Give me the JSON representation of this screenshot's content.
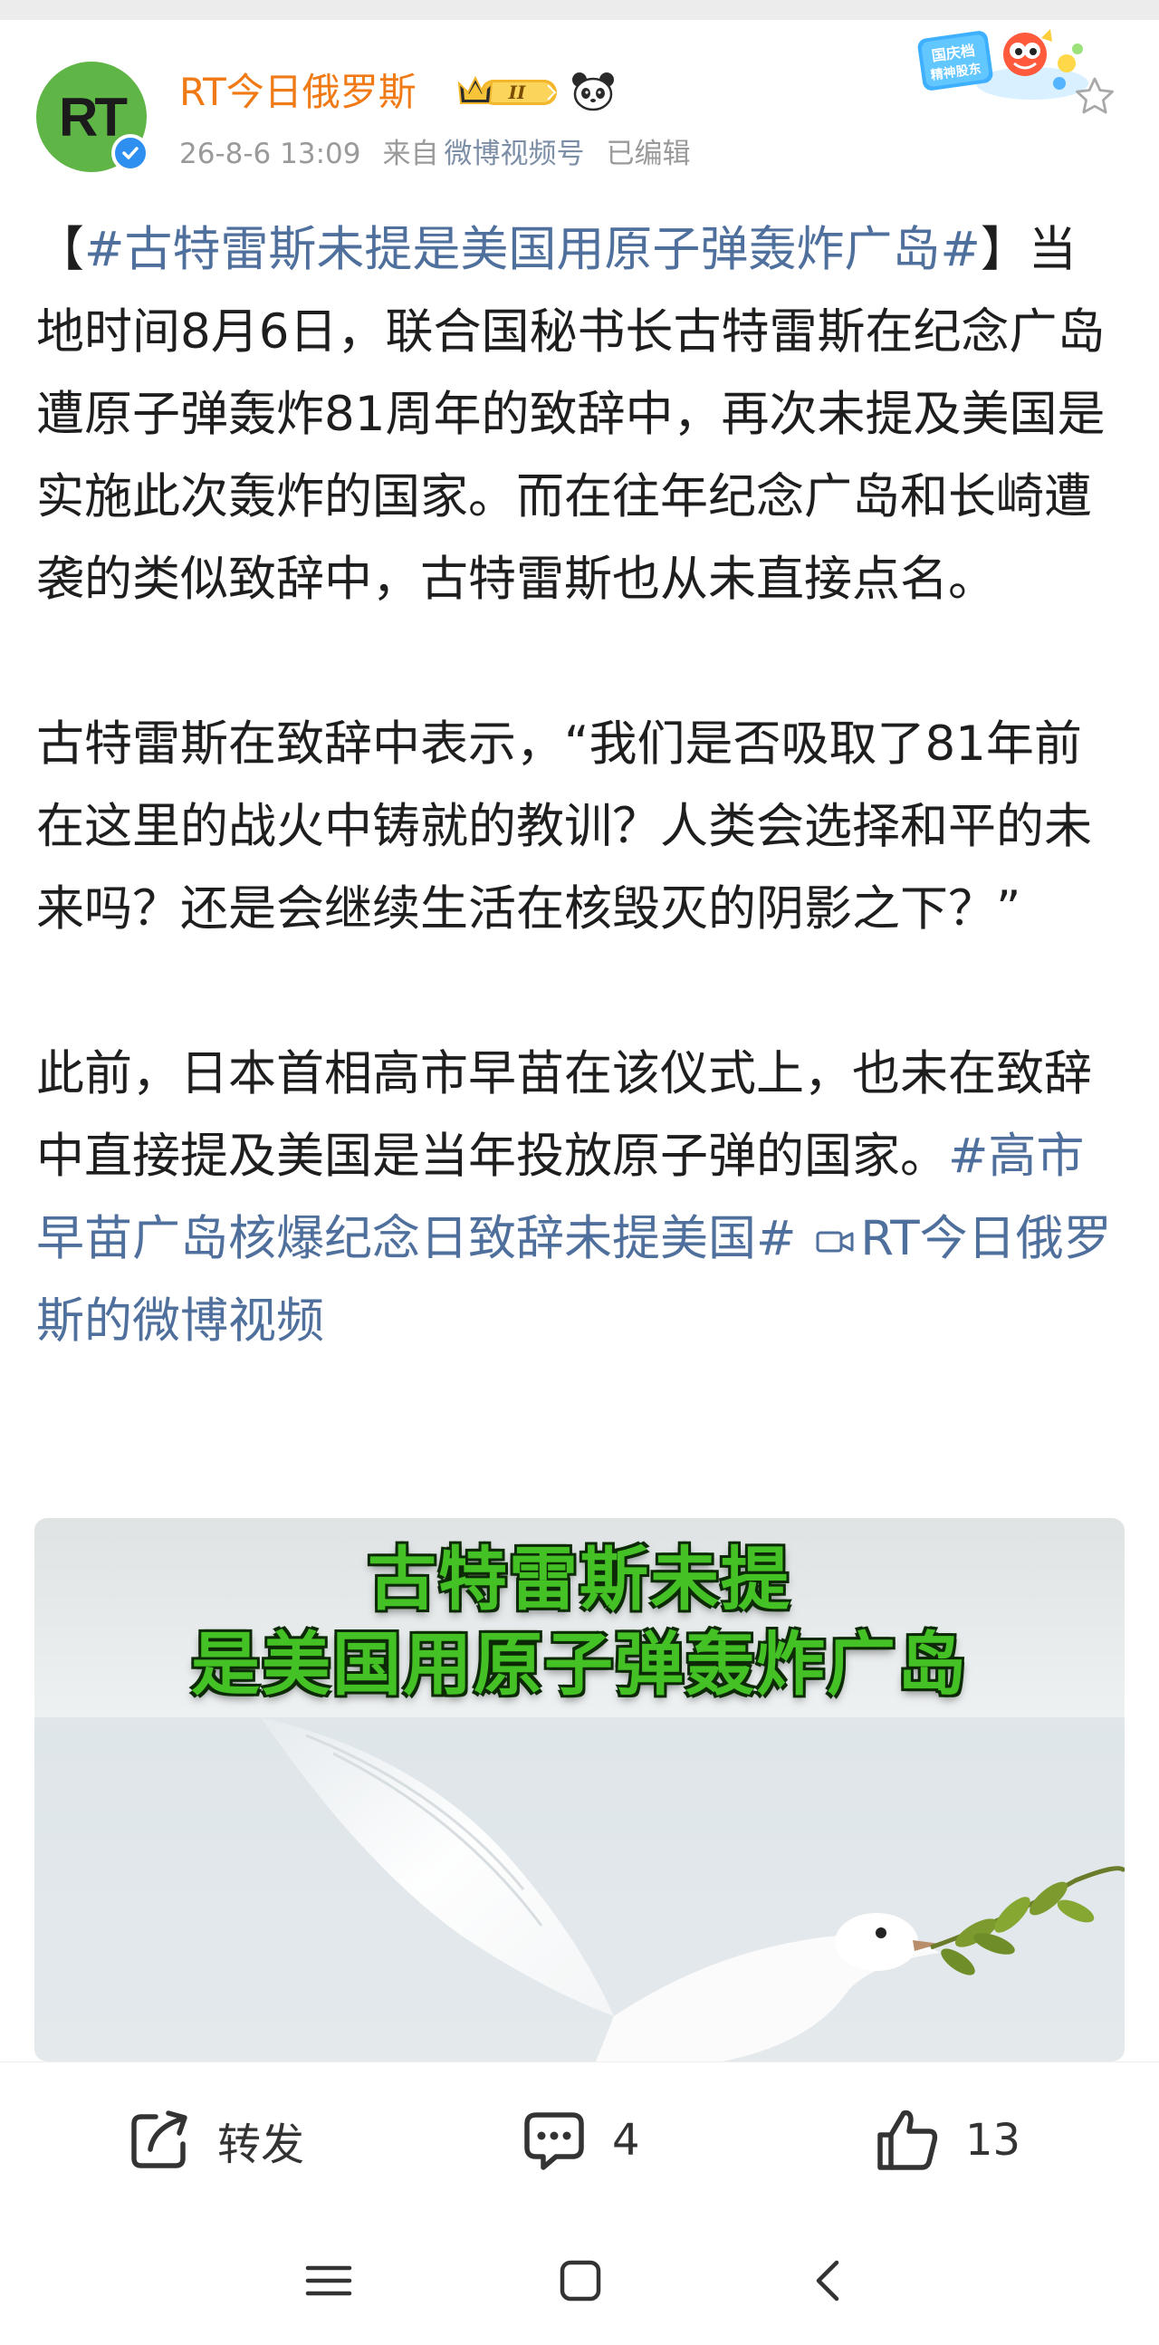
{
  "post": {
    "author": "RT今日俄罗斯",
    "avatar_text": "RT",
    "timestamp": "26-8-6 13:09",
    "source_prefix": "来自",
    "source": "微博视频号",
    "edited": "已编辑",
    "badges": [
      "crown-level-badge",
      "panda-icon",
      "festival-badge",
      "star-icon"
    ],
    "crown_level": "II",
    "festival_badge_text": [
      "国庆档",
      "精神股东"
    ]
  },
  "content": {
    "p1_open": "【",
    "p1_hashtag": "#古特雷斯未提是美国用原子弹轰炸广岛#",
    "p1_rest": "】当地时间8月6日，联合国秘书长古特雷斯在纪念广岛遭原子弹轰炸81周年的致辞中，再次未提及美国是实施此次轰炸的国家。而在往年纪念广岛和长崎遭袭的类似致辞中，古特雷斯也从未直接点名。",
    "p2": "古特雷斯在致辞中表示，“我们是否吸取了81年前在这里的战火中铸就的教训？人类会选择和平的未来吗？还是会继续生活在核毁灭的阴影之下？”",
    "p3": "此前，日本首相高市早苗在该仪式上，也未在致辞中直接提及美国是当年投放原子弹的国家。",
    "p3_hashtag": "#高市早苗广岛核爆纪念日致辞未提美国#",
    "video_link": "RT今日俄罗斯的微博视频"
  },
  "video": {
    "title_line1": "古特雷斯未提",
    "title_line2": "是美国用原子弹轰炸广岛"
  },
  "actions": {
    "repost_label": "转发",
    "comment_count": "4",
    "like_count": "13"
  },
  "colors": {
    "author": "#f07b16",
    "hashtag": "#4f6f9c",
    "meta": "#9a9a9a",
    "video_title": "#44c225",
    "avatar_bg": "#5fb546"
  }
}
